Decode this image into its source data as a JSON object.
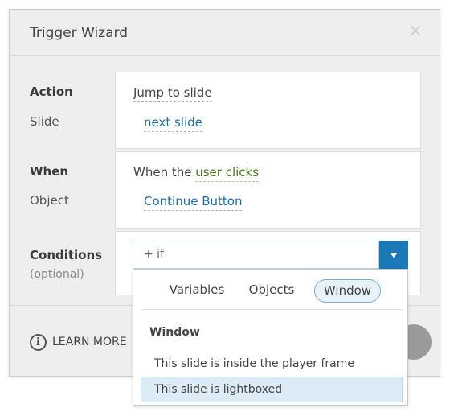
{
  "dialog": {
    "title": "Trigger Wizard",
    "close_glyph": "×",
    "close_icon": "close-icon"
  },
  "action": {
    "label": "Action",
    "value": "Jump to slide",
    "sub_label": "Slide",
    "sub_value": "next slide"
  },
  "when": {
    "label": "When",
    "prefix": "When the ",
    "value": "user clicks",
    "sub_label": "Object",
    "sub_value": "Continue Button"
  },
  "conditions": {
    "label": "Conditions",
    "sub_label": "(optional)",
    "input_value": "+ if",
    "dropdown_icon": "chevron-down-icon"
  },
  "menu": {
    "tabs": [
      {
        "label": "Variables",
        "active": false
      },
      {
        "label": "Objects",
        "active": false
      },
      {
        "label": "Window",
        "active": true
      }
    ],
    "heading": "Window",
    "items": [
      {
        "label": "This slide is inside the player frame",
        "selected": false
      },
      {
        "label": "This slide is lightboxed",
        "selected": true
      }
    ]
  },
  "footer": {
    "learn_more": "LEARN MORE",
    "info_glyph": "i",
    "info_icon": "info-icon"
  },
  "colors": {
    "accent": "#1c79b7",
    "link": "#1b6fa4",
    "highlight": "#4b7a1c",
    "selected_bg": "#dcebf6"
  }
}
